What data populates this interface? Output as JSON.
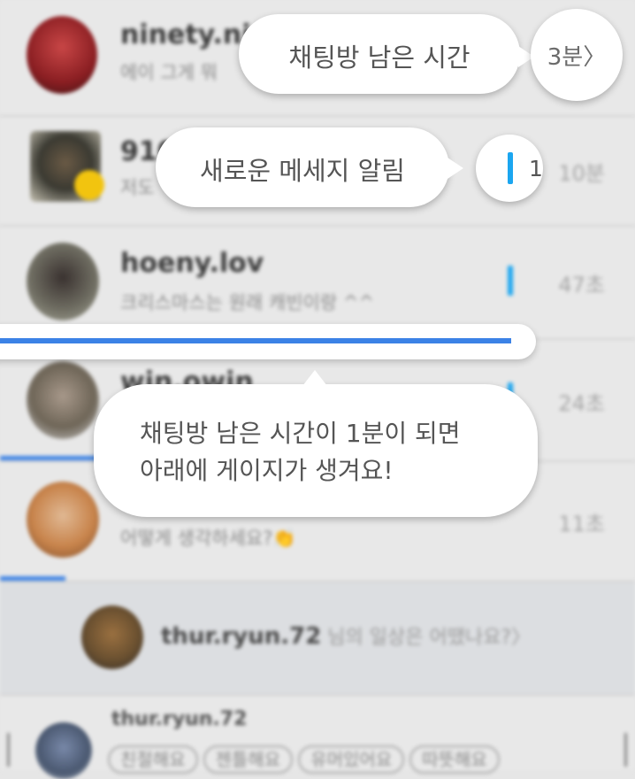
{
  "chats": [
    {
      "name": "ninety.ni",
      "preview": "에이 그게 뭐",
      "time": "3분",
      "unread": false
    },
    {
      "name": "910",
      "preview": "저도",
      "time": "10분",
      "unread": true
    },
    {
      "name": "hoeny.lov",
      "preview": "크리스마스는 원래 캐빈이랑 ^^",
      "time": "47초",
      "unread": true
    },
    {
      "name": "win.owin",
      "preview": "",
      "time": "24초",
      "unread": true
    },
    {
      "name": "",
      "preview": "어떻게 생각하세요?👏",
      "time": "11초",
      "unread": false
    }
  ],
  "daily_banner": {
    "name": "thur.ryun.72",
    "question": " 님의 일상은 어땠나요?〉"
  },
  "feedback_row": {
    "name": "thur.ryun.72",
    "chips": [
      "친절해요",
      "젠틀해요",
      "유머있어요",
      "따뜻해요"
    ]
  },
  "tooltips": {
    "remaining_time": "채팅방 남은 시간",
    "remaining_time_value": "3분〉",
    "new_message": "새로운 메세지 알림",
    "new_message_value": "1",
    "gauge_line1": "채팅방 남은 시간이 1분이 되면",
    "gauge_line2": "아래에 게이지가 생겨요!"
  },
  "colors": {
    "unread_bar": "#1ba6f0",
    "gauge": "#3b82e6",
    "background": "#e6e6e6"
  }
}
